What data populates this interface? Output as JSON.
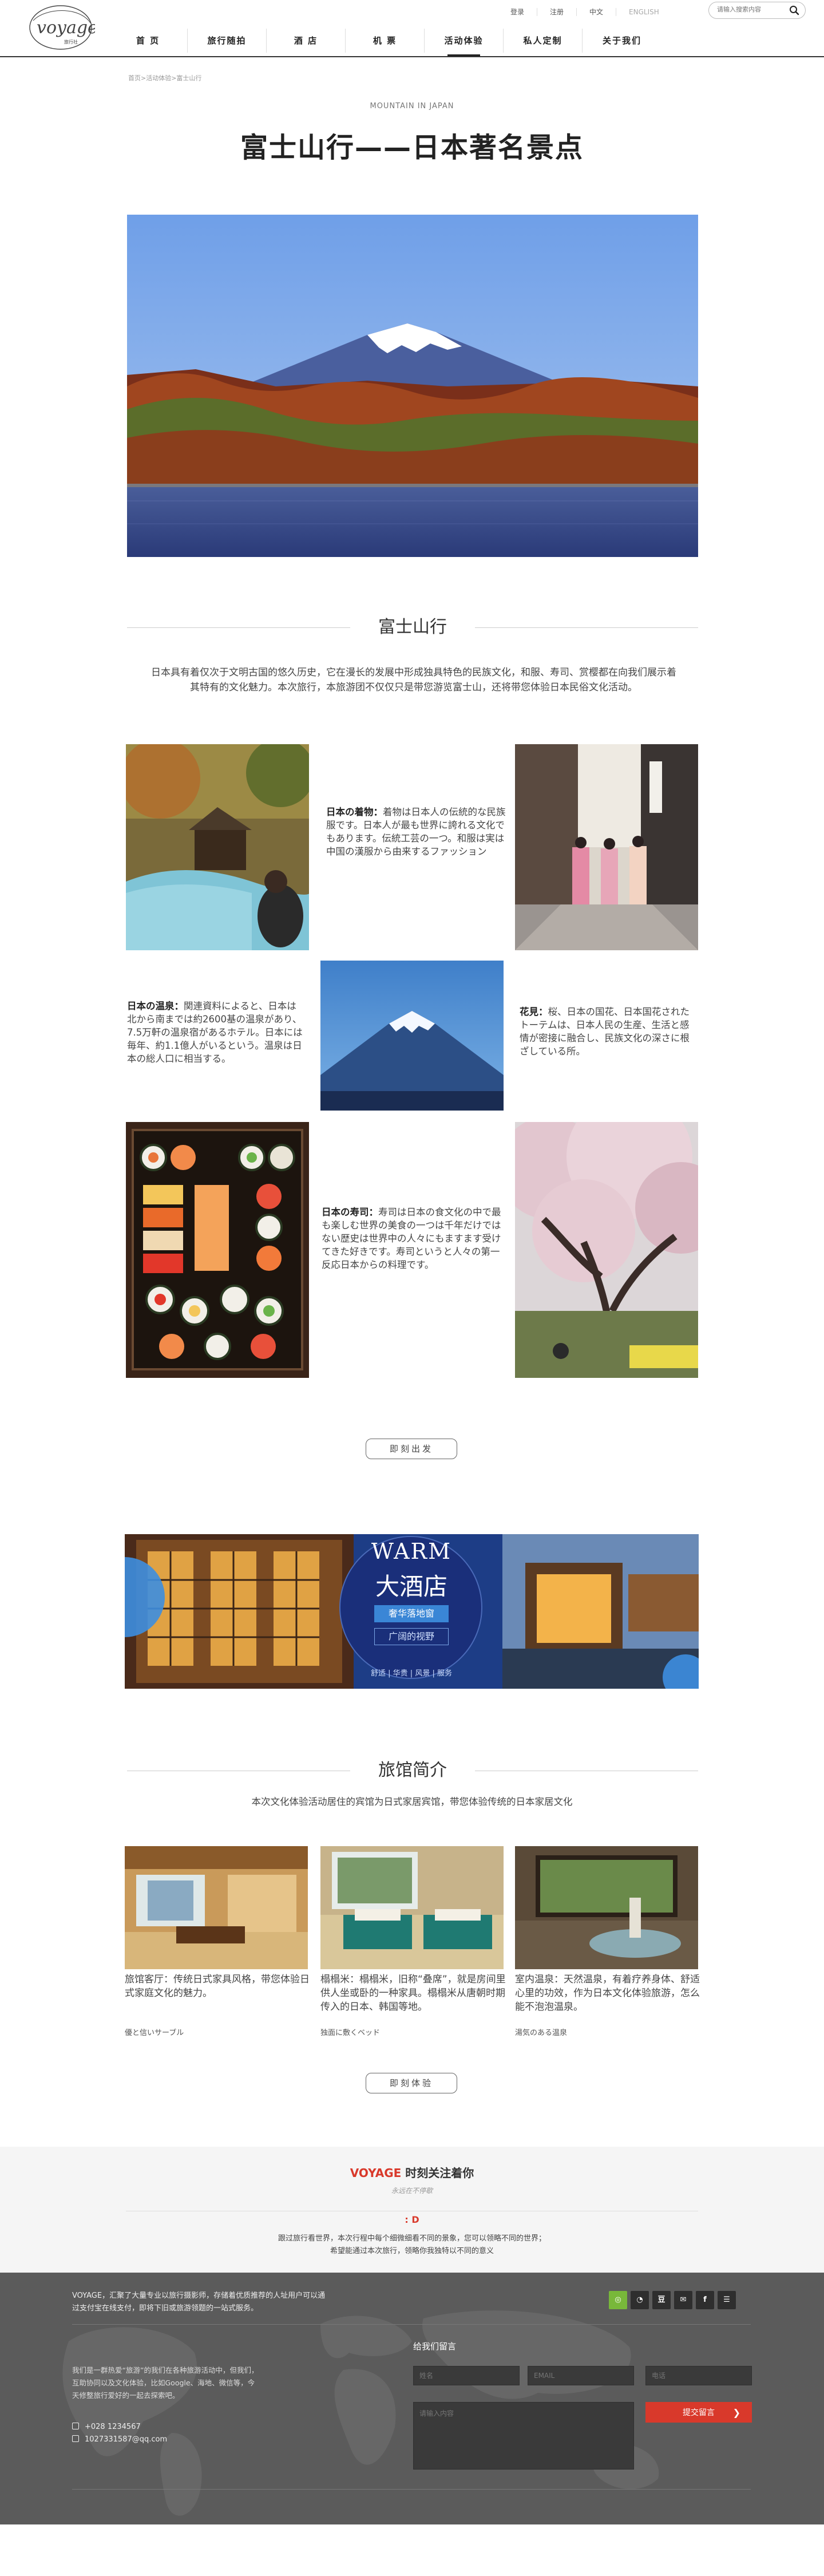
{
  "header": {
    "logo_text": "voyage",
    "logo_sub": "旅行社",
    "top_links": [
      "登录",
      "注册",
      "中文",
      "ENGLISH"
    ],
    "search_placeholder": "请输入搜索内容",
    "nav": [
      "首 页",
      "旅行随拍",
      "酒 店",
      "机 票",
      "活动体验",
      "私人定制",
      "关于我们"
    ],
    "active_nav": "活动体验"
  },
  "breadcrumb": "首页>活动体验>富士山行",
  "page": {
    "eyebrow": "MOUNTAIN IN JAPAN",
    "title": "富士山行——日本著名景点"
  },
  "section_fuji": {
    "heading": "富士山行",
    "intro": "日本具有着仅次于文明古国的悠久历史，它在漫长的发展中形成独具特色的民族文化，和服、寿司、赏樱都在向我们展示着其特有的文化魅力。本次旅行，本旅游团不仅仅只是带您游览富士山，还将带您体验日本民俗文化活动。"
  },
  "culture": {
    "kimono_title": "日本の着物：",
    "kimono_text": "着物は日本人の伝統的な民族服です。日本人が最も世界に誇れる文化でもあります。伝統工芸の一つ。和服は実は中国の漢服から由来するファッション",
    "onsen_title": "日本の温泉：",
    "onsen_text": "関連資料によると、日本は北から南までは約2600基の温泉があり、7.5万軒の温泉宿があるホテル。日本には毎年、約1.1億人がいるという。温泉は日本の総人口に相当する。",
    "hanami_title": "花見：",
    "hanami_text": "桜、日本の国花、日本国花されたトーテムは、日本人民の生産、生活と感情が密接に融合し、民族文化の深さに根ざしている所。",
    "sushi_title": "日本の寿司：",
    "sushi_text": "寿司は日本の食文化の中で最も楽しむ世界の美食の一つは千年だけではない歴史は世界中の人々にもますます受けてきた好きです。寿司というと人々の第一反応日本からの料理です。"
  },
  "buttons": {
    "depart": "即刻出发",
    "experience": "即刻体验"
  },
  "banner": {
    "title_en": "WARM",
    "title_cn": "大酒店",
    "tag1": "奢华落地窗",
    "tag2": "广阔的视野",
    "tags": "舒适 | 华贵 | 风景 | 服务"
  },
  "hotel": {
    "heading": "旅馆简介",
    "subtitle": "本次文化体验活动居住的宾馆为日式家居宾馆，带您体验传统的日本家居文化",
    "cards": [
      {
        "desc": "旅馆客厅：传统日式家具风格，带您体验日式家庭文化的魅力。",
        "tag": "優と信いサーブル"
      },
      {
        "desc": "榻榻米：榻榻米，旧称“叠席”，就是房间里供人坐或卧的一种家具。榻榻米从唐朝时期传入的日本、韩国等地。",
        "tag": "独面に敷くベッド"
      },
      {
        "desc": "室内温泉：天然温泉，有着疗养身体、舒适心里的功效，作为日本文化体验旅游，怎么能不泡泡温泉。",
        "tag": "湯気のある温泉"
      }
    ]
  },
  "follow": {
    "brand": "VOYAGE",
    "title_rest": " 时刻关注着你",
    "subtitle": "永远在不停歇",
    "mark": ": D",
    "line1": "跟过旅行看世界，本次行程中每个细微细看不同的景象，您可以领略不同的世界；",
    "line2": "希望能通过本次旅行，领略你我独特以不同的意义"
  },
  "footer": {
    "about": "VOYAGE，汇聚了大量专业以旅行摄影师，存储着优质推荐的人址用户可以通过支付宝在线支付，即将下旧或旅游领题的一站式服务。",
    "desc": "我们是一群热爱“旅游”的我们在各种旅游活动中，但我们，互助协同以及文化体验，比如Google、海地、微信等，今天修整旅行爱好的一起去探索吧。",
    "phone": "+028 1234567",
    "email": "1027331587@qq.com",
    "form_title": "给我们留言",
    "name_ph": "姓名",
    "email_ph": "EMAIL",
    "phone_ph": "电话",
    "message_ph": "请输入内容",
    "submit": "提交留言",
    "social_icons": [
      "wechat-icon",
      "qq-icon",
      "douban-icon",
      "message-icon",
      "facebook-icon",
      "rss-icon"
    ]
  },
  "colors": {
    "accent": "#d9392b",
    "footer_bg": "#5b5b5b",
    "banner_blue": "#1c3f8a",
    "wechat_green": "#78b83a"
  }
}
